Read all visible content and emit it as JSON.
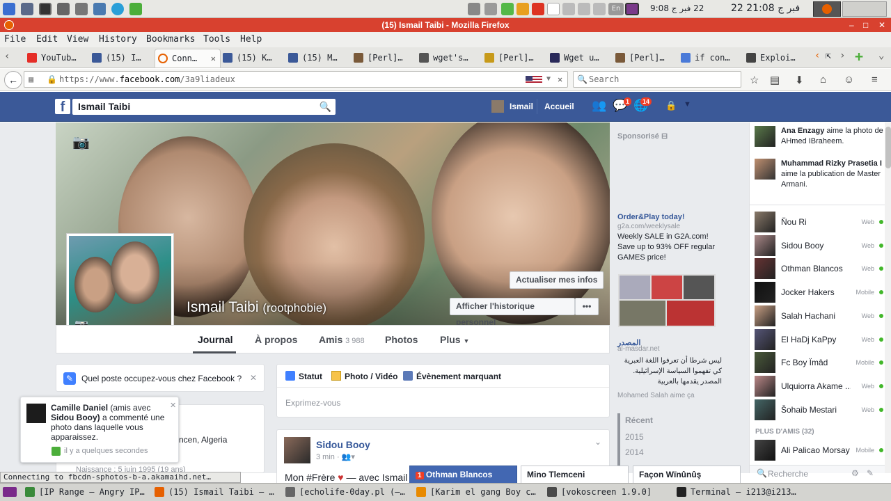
{
  "system": {
    "clock_left": "22 فبر ج 21:08",
    "clock_right": "22 فبر ج 9:08",
    "kb": "En"
  },
  "window": {
    "title": "(15) Ismail Taibi - Mozilla Firefox"
  },
  "menu": [
    "File",
    "Edit",
    "View",
    "History",
    "Bookmarks",
    "Tools",
    "Help"
  ],
  "tabs": [
    {
      "label": "YouTub…",
      "icon": "youtube-icon",
      "color": "#e52d27"
    },
    {
      "label": "(15) I…",
      "icon": "facebook-icon",
      "color": "#3b5998"
    },
    {
      "label": "Conn…",
      "icon": "loading-icon",
      "color": "#e66000"
    },
    {
      "label": "(15) K…",
      "icon": "facebook-icon",
      "color": "#3b5998"
    },
    {
      "label": "(15) M…",
      "icon": "facebook-icon",
      "color": "#3b5998"
    },
    {
      "label": "[Perl]…",
      "icon": "perl-icon",
      "color": "#7a5a3a"
    },
    {
      "label": "wget's…",
      "icon": "page-icon",
      "color": "#555555"
    },
    {
      "label": "[Perl]…",
      "icon": "perl-icon",
      "color": "#c79a1a"
    },
    {
      "label": "Wget u…",
      "icon": "perl-icon",
      "color": "#2a2a5a"
    },
    {
      "label": "[Perl]…",
      "icon": "perl-icon",
      "color": "#7a5a3a"
    },
    {
      "label": "if con…",
      "icon": "google-icon",
      "color": "#4a7ad8"
    },
    {
      "label": "Exploi…",
      "icon": "page-icon",
      "color": "#444444"
    }
  ],
  "nav": {
    "url_prefix": "https://www.",
    "url_domain": "facebook.com",
    "url_path": "/3a9liadeux",
    "search_placeholder": "Search"
  },
  "fb": {
    "search_value": "Ismail Taibi",
    "user_name": "Ismail",
    "home": "Accueil",
    "msg_badge": "1",
    "notif_badge": "14",
    "profile_name": "Ismail Taibi",
    "profile_alt": "(rootphobie)",
    "btn_update": "Actualiser mes infos",
    "btn_history": "Afficher l'historique personnel",
    "btn_more": "•••",
    "tabs": {
      "journal": "Journal",
      "about": "À propos",
      "friends": "Amis",
      "friends_count": "3 988",
      "photos": "Photos",
      "more": "Plus"
    },
    "job_prompt": "Quel poste occupez-vous chez Facebook ?",
    "composer": {
      "status": "Statut",
      "photo": "Photo / Vidéo",
      "event": "Évènement marquant",
      "placeholder": "Exprimez-vous"
    },
    "post": {
      "author": "Sidou Booy",
      "time": "3 min ·",
      "text_start": "Mon #Frère",
      "text_with": "— avec Ismail"
    },
    "intro": {
      "location": "ncen, Algeria",
      "birth": "Naissance : 5 juin 1995 (19 ans)"
    },
    "notif_popup": {
      "actor": "Camille Daniel",
      "mid": "(amis avec",
      "friend": "Sidou Booy)",
      "rest": "a commenté une photo dans laquelle vous apparaissez.",
      "time": "il y a quelques secondes"
    },
    "sponsored": {
      "label": "Sponsorisé",
      "ad1_title": "Order&Play today!",
      "ad1_url": "g2a.com/weeklysale",
      "ad1_text": "Weekly SALE in G2A.com! Save up to 93% OFF regular GAMES price!",
      "ad2_title": "المصدر",
      "ad2_url": "al-masdar.net",
      "ad2_text": "ليس شرطا أن تعرفوا اللغة العبرية كي تفهموا السياسة الإسرائيلية. المصدر يقدمها بالعربية",
      "ad2_like": "Mohamed Salah aime ça"
    },
    "years": {
      "recent": "Récent",
      "y1": "2015",
      "y2": "2014"
    },
    "ticker": [
      {
        "name": "Ana Enzagy",
        "action": "aime la photo de AHmed IBraheem."
      },
      {
        "name": "Muhammad Rizky Prasetia I",
        "action": "aime la publication de Master Armani."
      }
    ],
    "chat": [
      {
        "name": "Ňou Ri",
        "status": "Web"
      },
      {
        "name": "Sidou Booy",
        "status": "Web"
      },
      {
        "name": "Othman Blancos",
        "status": "Web"
      },
      {
        "name": "Jocker Hakers",
        "status": "Mobile"
      },
      {
        "name": "Salah Hachani",
        "status": "Web"
      },
      {
        "name": "El HaDj KaPpy",
        "status": "Web"
      },
      {
        "name": "Fc Boy Ïmâd",
        "status": "Mobile"
      },
      {
        "name": "Ulquiorra Akame ...",
        "status": "Web"
      },
      {
        "name": "Šohaib Mestari",
        "status": "Web"
      }
    ],
    "more_friends": "PLUS D'AMIS (32)",
    "chat_extra": {
      "name": "Ali Palicao Morsay",
      "status": "Mobile"
    },
    "chat_search": "Recherche",
    "chat_tabs": [
      {
        "name": "Othman Blancos",
        "badge": "1"
      },
      {
        "name": "Mino Tlemceni"
      },
      {
        "name": "Façon Wïnûnûş"
      }
    ]
  },
  "statusbar": "Connecting to fbcdn-sphotos-b-a.akamaihd.net…",
  "taskbar": [
    {
      "label": "[IP Range – Angry IP…",
      "icon": "angryip-icon"
    },
    {
      "label": "(15) Ismail Taibi – …",
      "icon": "firefox-icon"
    },
    {
      "label": "[echolife-0day.pl (–…",
      "icon": "editor-icon"
    },
    {
      "label": "[Karim el gang Boy c…",
      "icon": "vlc-icon"
    },
    {
      "label": "[vokoscreen 1.9.0]",
      "icon": "camera-icon"
    },
    {
      "label": "Terminal – i213@i213…",
      "icon": "terminal-icon"
    }
  ]
}
